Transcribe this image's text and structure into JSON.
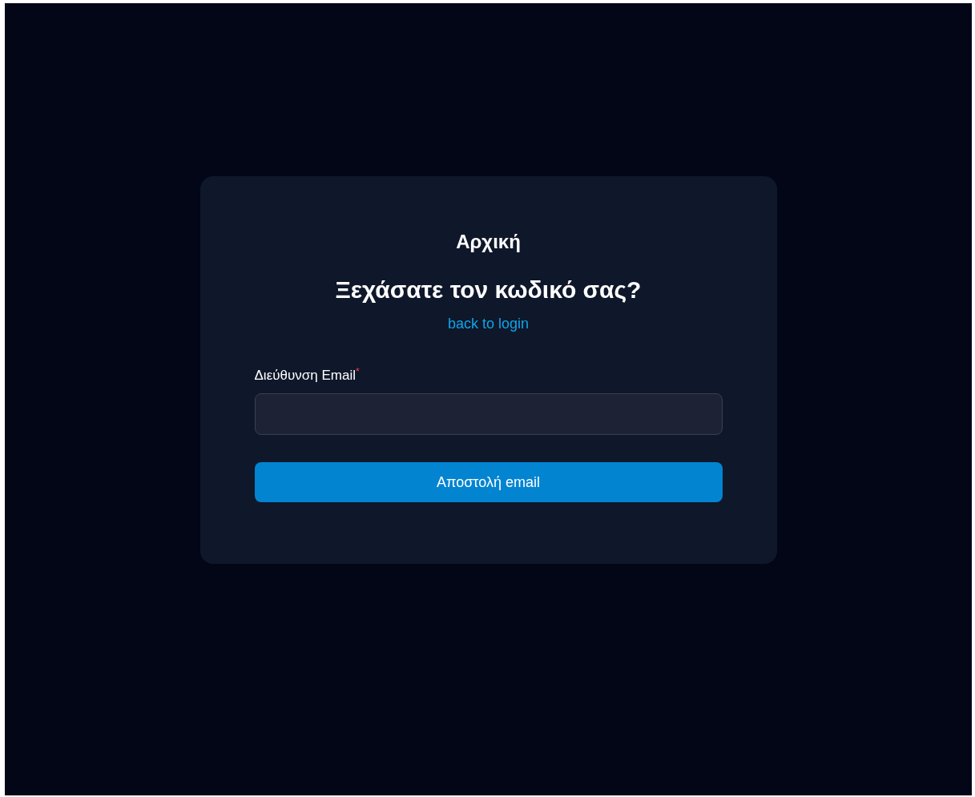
{
  "brand": "Αρχική",
  "heading": "Ξεχάσατε τον κωδικό σας?",
  "back_link": "back to login",
  "email_field": {
    "label": "Διεύθυνση Email",
    "required_mark": "*"
  },
  "submit_button": "Αποστολή email"
}
